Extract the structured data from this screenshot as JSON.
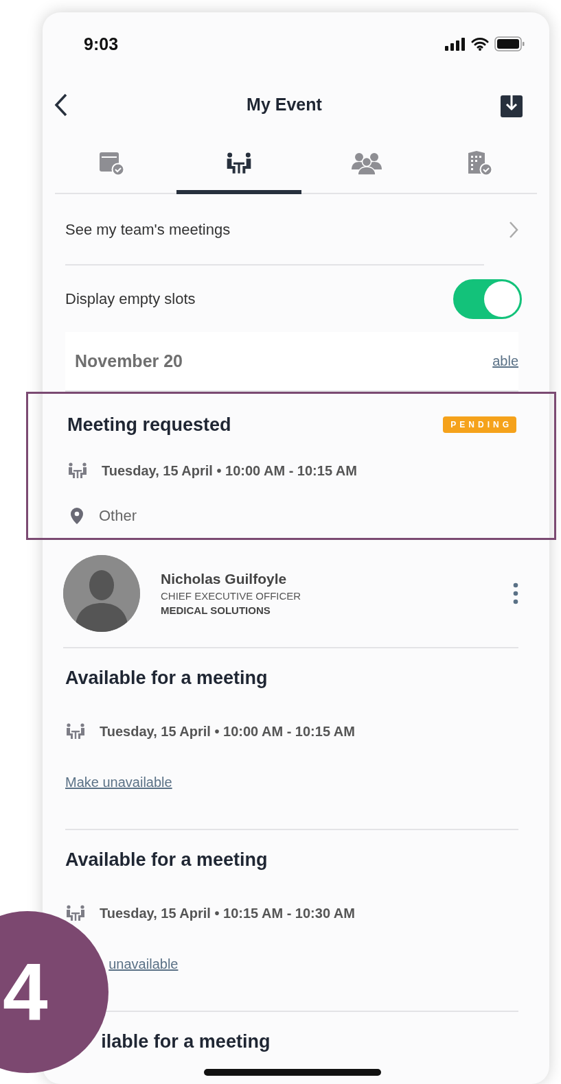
{
  "status_bar": {
    "time": "9:03"
  },
  "header": {
    "title": "My Event"
  },
  "tabs": [
    {
      "selected": false
    },
    {
      "selected": true
    },
    {
      "selected": false
    },
    {
      "selected": false
    }
  ],
  "team_link": {
    "label": "See my team's meetings"
  },
  "empty_slots": {
    "label": "Display empty slots",
    "on": true
  },
  "date_header": {
    "date": "November 20",
    "link": "able"
  },
  "requested": {
    "title": "Meeting requested",
    "status": "PENDING",
    "when": "Tuesday, 15 April • 10:00 AM - 10:15 AM",
    "location": "Other",
    "highlighted": true
  },
  "contact": {
    "name": "Nicholas Guilfoyle",
    "role": "CHIEF EXECUTIVE OFFICER",
    "company": "MEDICAL SOLUTIONS"
  },
  "slots": [
    {
      "title": "Available for a meeting",
      "when": "Tuesday, 15 April • 10:00 AM - 10:15 AM",
      "action": "Make unavailable"
    },
    {
      "title": "Available for a meeting",
      "when": "Tuesday, 15 April • 10:15 AM - 10:30 AM",
      "action": "unavailable"
    },
    {
      "title": "ilable for a meeting"
    }
  ],
  "step_badge": {
    "number": "4"
  }
}
